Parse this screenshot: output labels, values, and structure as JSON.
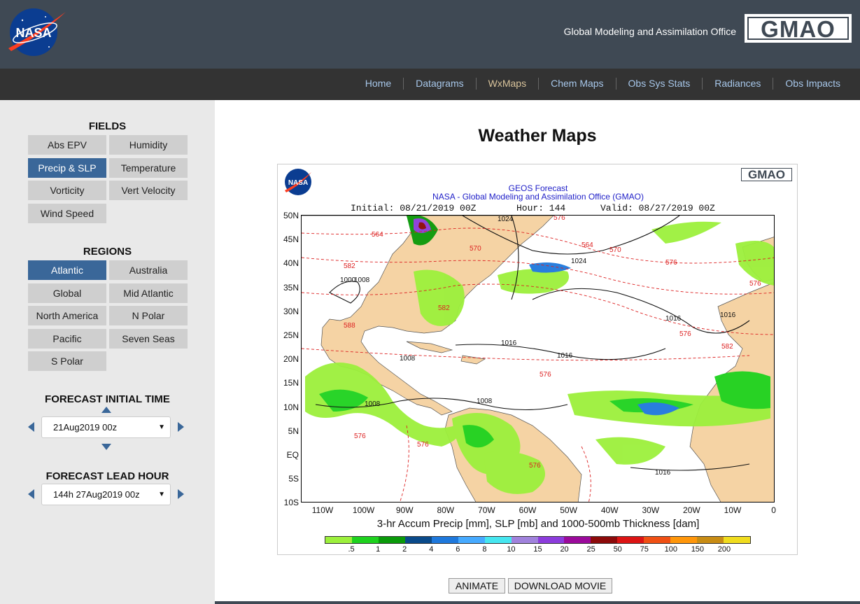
{
  "header": {
    "nasa_logo_text": "NASA",
    "org_name": "Global Modeling and Assimilation Office",
    "gmao_logo_text": "GMAO"
  },
  "nav": {
    "items": [
      {
        "label": "Home",
        "active": false
      },
      {
        "label": "Datagrams",
        "active": false
      },
      {
        "label": "WxMaps",
        "active": true
      },
      {
        "label": "Chem Maps",
        "active": false
      },
      {
        "label": "Obs Sys Stats",
        "active": false
      },
      {
        "label": "Radiances",
        "active": false
      },
      {
        "label": "Obs Impacts",
        "active": false
      }
    ]
  },
  "sidebar": {
    "fields_title": "FIELDS",
    "fields": [
      "Abs EPV",
      "Humidity",
      "Precip & SLP",
      "Temperature",
      "Vorticity",
      "Vert Velocity",
      "Wind Speed"
    ],
    "fields_selected": "Precip & SLP",
    "regions_title": "REGIONS",
    "regions": [
      "Atlantic",
      "Australia",
      "Global",
      "Mid Atlantic",
      "North America",
      "N Polar",
      "Pacific",
      "Seven Seas",
      "S Polar"
    ],
    "regions_selected": "Atlantic",
    "initial_time_title": "FORECAST INITIAL TIME",
    "initial_time_value": "21Aug2019 00z",
    "lead_hour_title": "FORECAST LEAD HOUR",
    "lead_hour_value": "144h 27Aug2019 00z"
  },
  "main": {
    "title": "Weather Maps",
    "figure": {
      "nasa_mini": "NASA",
      "gmao_mini": "GMAO",
      "line1": "GEOS Forecast",
      "line2": "NASA - Global Modeling and Assimilation Office (GMAO)",
      "initial": "Initial: 08/21/2019 00Z",
      "hour": "Hour: 144",
      "valid": "Valid: 08/27/2019 00Z",
      "lat_labels": [
        "50N",
        "45N",
        "40N",
        "35N",
        "30N",
        "25N",
        "20N",
        "15N",
        "10N",
        "5N",
        "EQ",
        "5S",
        "10S"
      ],
      "lon_labels": [
        "110W",
        "100W",
        "90W",
        "80W",
        "70W",
        "60W",
        "50W",
        "40W",
        "30W",
        "20W",
        "10W",
        "0"
      ],
      "caption": "3-hr Accum Precip [mm], SLP [mb] and 1000-500mb Thickness [dam]",
      "colorbar_labels": [
        ".5",
        "1",
        "2",
        "4",
        "6",
        "8",
        "10",
        "15",
        "20",
        "25",
        "50",
        "75",
        "100",
        "150",
        "200"
      ],
      "colorbar_colors": [
        "#9cf03c",
        "#1ed21e",
        "#0a9a0a",
        "#0a4a8a",
        "#1e78dc",
        "#46aaff",
        "#46e6f0",
        "#a082dc",
        "#8c3cdc",
        "#9b0a9b",
        "#8c0a0a",
        "#dc1414",
        "#f05014",
        "#ff960a",
        "#c88c14",
        "#f0dc1e"
      ],
      "contour_labels": [
        "1024",
        "1024",
        "1016",
        "1016",
        "1016",
        "1016",
        "1008",
        "1008",
        "1008",
        "1008",
        "1000",
        "1016",
        "576",
        "576",
        "570",
        "570",
        "564",
        "564",
        "582",
        "582",
        "588",
        "582",
        "576",
        "576",
        "576",
        "576",
        "576",
        "576"
      ]
    },
    "animate_label": "ANIMATE",
    "download_label": "DOWNLOAD MOVIE"
  },
  "colors": {
    "header_bg": "#3f4954",
    "nav_bg": "#333333",
    "nav_link": "#a7c7ea",
    "nav_active": "#d8c39b",
    "selected_button": "#3a6799",
    "sidebar_bg": "#e9e9e9",
    "land": "#f5d3a4",
    "precip_light": "#9cf03c",
    "precip_mid": "#1ed21e"
  }
}
